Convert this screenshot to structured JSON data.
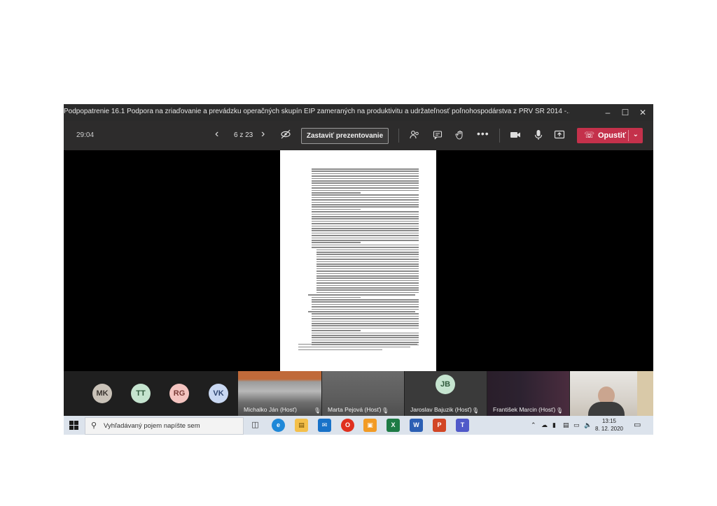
{
  "window": {
    "title": "Podpopatrenie 16.1 Podpora na zriaďovanie a prevádzku operačných skupín EIP zameraných na produktivitu a udržateľnosť poľnohospodárstva z PRV SR 2014 -..."
  },
  "toolbar": {
    "timer": "29:04",
    "page_indicator": "6 z 23",
    "stop_presenting_label": "Zastaviť prezentovanie",
    "leave_label": "Opustiť"
  },
  "participants": {
    "avatars": [
      {
        "initials": "MK",
        "bg": "#c9c2b8",
        "fg": "#3a3530"
      },
      {
        "initials": "TT",
        "bg": "#c5e4cf",
        "fg": "#2f5a3c"
      },
      {
        "initials": "RG",
        "bg": "#f4c4c0",
        "fg": "#7a3b36"
      },
      {
        "initials": "VK",
        "bg": "#c9d8f2",
        "fg": "#2f4671"
      }
    ],
    "tiles": [
      {
        "name": "Michalko Ján (Hosť)"
      },
      {
        "name": "Marta Pejová (Hosť)"
      },
      {
        "name": "Jaroslav Bajuzik (Hosť)",
        "initials": "JB"
      },
      {
        "name": "František Marcin (Hosť)"
      }
    ]
  },
  "taskbar": {
    "search_placeholder": "Vyhľadávaný pojem napíšte sem",
    "time": "13:15",
    "date": "8. 12. 2020"
  },
  "colors": {
    "leave": "#c4314b",
    "teams_dark": "#1f1f1f",
    "taskbar": "#dce3ec"
  }
}
